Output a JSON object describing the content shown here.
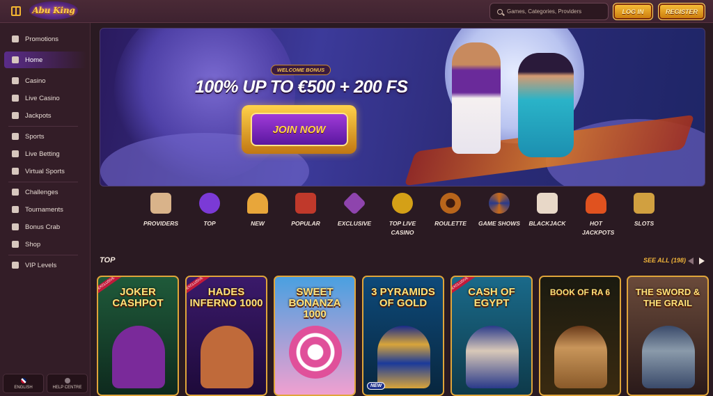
{
  "header": {
    "logo_text": "Abu King",
    "search_placeholder": "Games, Categories, Providers",
    "login_label": "LOG IN",
    "register_label": "REGISTER"
  },
  "sidebar": {
    "items": [
      {
        "label": "Promotions",
        "icon": "gift-icon"
      },
      {
        "label": "Home",
        "icon": "home-icon",
        "active": true
      },
      {
        "label": "Casino",
        "icon": "slot-machine-icon"
      },
      {
        "label": "Live Casino",
        "icon": "live-casino-icon"
      },
      {
        "label": "Jackpots",
        "icon": "jackpot-icon"
      },
      {
        "label": "Sports",
        "icon": "sports-icon"
      },
      {
        "label": "Live Betting",
        "icon": "live-betting-icon"
      },
      {
        "label": "Virtual Sports",
        "icon": "virtual-sports-icon"
      },
      {
        "label": "Challenges",
        "icon": "medal-icon"
      },
      {
        "label": "Tournaments",
        "icon": "trophy-icon"
      },
      {
        "label": "Bonus Crab",
        "icon": "crab-icon"
      },
      {
        "label": "Shop",
        "icon": "shop-icon"
      },
      {
        "label": "VIP Levels",
        "icon": "diamond-icon"
      }
    ],
    "footer": {
      "language_label": "ENGLISH",
      "help_label": "HELP CENTRE"
    }
  },
  "banner": {
    "badge": "WELCOME BONUS",
    "headline": "100% UP TO €500 + 200 FS",
    "cta_label": "JOIN NOW"
  },
  "categories": [
    {
      "label": "PROVIDERS",
      "icon": "scroll-icon",
      "color": "#d9b38a"
    },
    {
      "label": "TOP",
      "icon": "star-icon",
      "color": "#7b3ad6"
    },
    {
      "label": "NEW",
      "icon": "magic-lamp-icon",
      "color": "#e8a63a"
    },
    {
      "label": "POPULAR",
      "icon": "carpet-icon",
      "color": "#c0392b"
    },
    {
      "label": "EXCLUSIVE",
      "icon": "gem-icon",
      "color": "#8e44ad"
    },
    {
      "label": "TOP LIVE CASINO",
      "icon": "chips-icon",
      "color": "#d4a017"
    },
    {
      "label": "ROULETTE",
      "icon": "roulette-icon",
      "color": "#b8651b"
    },
    {
      "label": "GAME SHOWS",
      "icon": "wheel-icon",
      "color": "#c76a1a"
    },
    {
      "label": "BLACKJACK",
      "icon": "cards-icon",
      "color": "#e8d8c8"
    },
    {
      "label": "HOT JACKPOTS",
      "icon": "flame-lamp-icon",
      "color": "#e0521f"
    },
    {
      "label": "SLOTS",
      "icon": "slot-icon",
      "color": "#d1a040"
    }
  ],
  "top_section": {
    "title": "TOP",
    "see_all": "SEE ALL (198)"
  },
  "games": [
    {
      "name": "JOKER CASHPOT",
      "ribbon": "EXCLUSIVE",
      "bg": "#1f5a3a",
      "char": "#7a2a9a"
    },
    {
      "name": "HADES INFERNO 1000",
      "ribbon": "EXCLUSIVE",
      "bg": "#3a1a6a",
      "char": "#c06a3a"
    },
    {
      "name": "SWEET BONANZA 1000",
      "ribbon": "",
      "bg": "#4aa0e0",
      "char": "#e0509a"
    },
    {
      "name": "3 PYRAMIDS OF GOLD",
      "ribbon": "",
      "bg": "#0e4a7a",
      "char": "#d8a53a",
      "badge": "NEW"
    },
    {
      "name": "CASH OF EGYPT",
      "ribbon": "EXCLUSIVE",
      "bg": "#1a6a8a",
      "char": "#2a3a8a"
    },
    {
      "name": "BOOK OF RA 6",
      "ribbon": "",
      "bg": "#1a1a10",
      "char": "#6a3a1a"
    },
    {
      "name": "THE SWORD & THE GRAIL",
      "ribbon": "",
      "bg": "#6a4a3a",
      "char": "#3a4a6a"
    }
  ]
}
